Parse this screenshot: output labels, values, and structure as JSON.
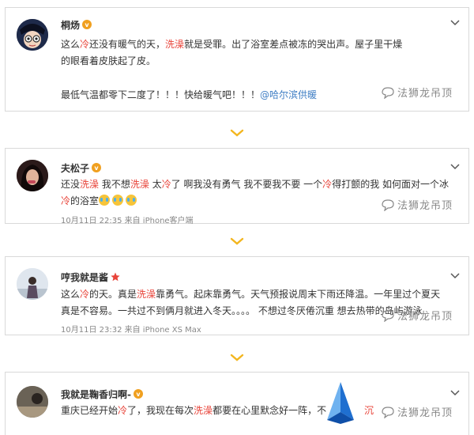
{
  "posts": [
    {
      "username": "桐炀",
      "text_parts": [
        {
          "t": "这么",
          "s": "n"
        },
        {
          "t": "冷",
          "s": "h"
        },
        {
          "t": "还没有暖气的天，",
          "s": "n"
        },
        {
          "t": "洗澡",
          "s": "h"
        },
        {
          "t": "就是受罪。出了浴室差点被冻的哭出声。屋子里干燥的眼看着皮肤起了皮。",
          "s": "n"
        }
      ],
      "text2_parts": [
        {
          "t": "最低气温都零下二度了！！！快给暖气吧！！！",
          "s": "n"
        },
        {
          "t": "@哈尔滨供暖",
          "s": "l"
        }
      ],
      "meta": "",
      "watermark": "法狮龙吊顶"
    },
    {
      "username": "夫松子",
      "text_parts": [
        {
          "t": "还没",
          "s": "n"
        },
        {
          "t": "洗澡",
          "s": "h"
        },
        {
          "t": " 我不想",
          "s": "n"
        },
        {
          "t": "洗澡",
          "s": "h"
        },
        {
          "t": " 太",
          "s": "n"
        },
        {
          "t": "冷",
          "s": "h"
        },
        {
          "t": "了 啊我没有勇气 我不要我不要 一个",
          "s": "n"
        },
        {
          "t": "冷",
          "s": "h"
        },
        {
          "t": "得打颤的我 如何面对一个冰",
          "s": "n"
        },
        {
          "t": "冷",
          "s": "h"
        },
        {
          "t": "的浴室",
          "s": "n"
        }
      ],
      "meta": "10月11日 22:35 来自 iPhone客户端",
      "watermark": "法狮龙吊顶"
    },
    {
      "username": "哼我就是酱",
      "text_parts": [
        {
          "t": "这么",
          "s": "n"
        },
        {
          "t": "冷",
          "s": "h"
        },
        {
          "t": "的天。真是",
          "s": "n"
        },
        {
          "t": "洗澡",
          "s": "h"
        },
        {
          "t": "靠勇气。起床靠勇气。天气预报说周末下雨还降温。一年里过个夏天真是不容易。一共过不到俩月就进入冬天。。。。 不想过冬厌倦沉重 想去热带的岛屿游泳",
          "s": "n"
        }
      ],
      "meta": "10月11日 23:32 来自 iPhone XS Max",
      "watermark": "法狮龙吊顶"
    },
    {
      "username": "我就是鞠香归啊-",
      "text_parts": [
        {
          "t": "重庆已经开始",
          "s": "n"
        },
        {
          "t": "冷",
          "s": "h"
        },
        {
          "t": "了，我现在每次",
          "s": "n"
        },
        {
          "t": "洗澡",
          "s": "h"
        },
        {
          "t": "都要在心里默念好一阵，不",
          "s": "n"
        }
      ],
      "text_tail": "沉",
      "meta": "",
      "watermark": "法狮龙吊顶"
    }
  ],
  "colors": {
    "highlight": "#e8443a",
    "link": "#3f7ec4",
    "chevron": "#f3b61f"
  }
}
